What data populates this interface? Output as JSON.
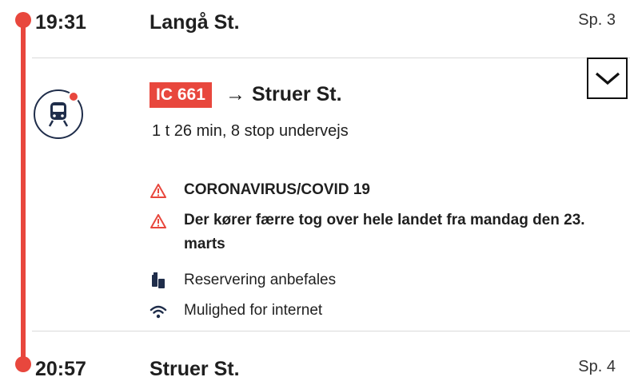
{
  "departure": {
    "time": "19:31",
    "station": "Langå St.",
    "track": "Sp. 3"
  },
  "arrival": {
    "time": "20:57",
    "station": "Struer St.",
    "track": "Sp. 4"
  },
  "train": {
    "line": "IC 661",
    "arrow": "→",
    "destination": "Struer St.",
    "duration": "1 t 26 min, 8 stop undervejs"
  },
  "notices": [
    {
      "text": "CORONAVIRUS/COVID 19",
      "icon": "warning-icon"
    },
    {
      "text": "Der kører færre tog over hele landet fra mandag den 23. marts",
      "icon": "warning-icon"
    }
  ],
  "info": [
    {
      "text": "Reservering anbefales",
      "icon": "seat-reservation-icon"
    },
    {
      "text": "Mulighed for internet",
      "icon": "wifi-icon"
    }
  ],
  "colors": {
    "accent": "#e8473d",
    "icon_navy": "#1f2d4a"
  }
}
